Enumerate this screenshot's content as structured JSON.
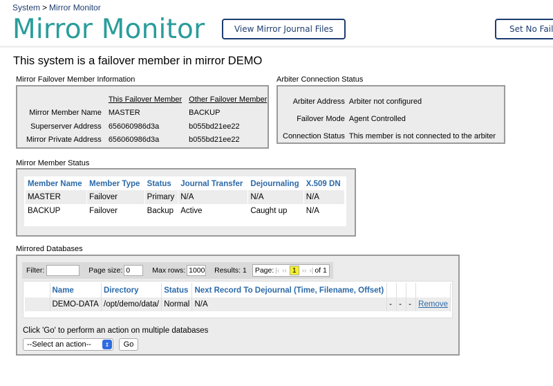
{
  "breadcrumb": {
    "items": [
      "System",
      "Mirror Monitor"
    ],
    "separator": ">"
  },
  "header": {
    "title": "Mirror Monitor",
    "buttons": {
      "journal": "View Mirror Journal Files",
      "set_no_failover": "Set No Failover"
    }
  },
  "main_heading": "This system is a failover member in mirror DEMO",
  "failover_info": {
    "title": "Mirror Failover Member Information",
    "col_this": "This Failover Member",
    "col_other": "Other Failover Member",
    "rows": [
      {
        "label": "Mirror Member Name",
        "this": "MASTER",
        "other": "BACKUP"
      },
      {
        "label": "Superserver Address",
        "this": "656060986d3a",
        "other": "b055bd21ee22"
      },
      {
        "label": "Mirror Private Address",
        "this": "656060986d3a",
        "other": "b055bd21ee22"
      }
    ]
  },
  "arbiter": {
    "title": "Arbiter Connection Status",
    "rows": [
      {
        "label": "Arbiter Address",
        "value": "Arbiter not configured"
      },
      {
        "label": "Failover Mode",
        "value": "Agent Controlled"
      },
      {
        "label": "Connection Status",
        "value": "This member is not connected to the arbiter"
      }
    ]
  },
  "member_status": {
    "title": "Mirror Member Status",
    "headers": [
      "Member Name",
      "Member Type",
      "Status",
      "Journal Transfer",
      "Dejournaling",
      "X.509 DN"
    ],
    "rows": [
      [
        "MASTER",
        "Failover",
        "Primary",
        "N/A",
        "N/A",
        "N/A"
      ],
      [
        "BACKUP",
        "Failover",
        "Backup",
        "Active",
        "Caught up",
        "N/A"
      ]
    ]
  },
  "databases": {
    "title": "Mirrored Databases",
    "filter_label": "Filter:",
    "filter_value": "",
    "page_size_label": "Page size:",
    "page_size": "0",
    "max_rows_label": "Max rows:",
    "max_rows": "1000",
    "results_label": "Results: 1",
    "page_label": "Page:",
    "pager": {
      "first": "|‹",
      "prev": "‹‹",
      "current": "1",
      "next": "››",
      "last": "›|",
      "of": "of 1"
    },
    "headers": [
      "Name",
      "Directory",
      "Status",
      "Next Record To Dejournal (Time, Filename, Offset)"
    ],
    "rows": [
      {
        "name": "DEMO-DATA",
        "directory": "/opt/demo/data/",
        "status": "Normal",
        "next": "N/A",
        "c1": "-",
        "c2": "-",
        "c3": "-",
        "action": "Remove"
      }
    ],
    "go_hint": "Click 'Go' to perform an action on multiple databases",
    "select_value": "--Select an action--",
    "go_label": "Go"
  },
  "colors": {
    "title": "#2a9d9b",
    "navy": "#1d3c6e",
    "link": "#2c6aa8",
    "panel": "#ececec",
    "border": "#9a9a9a",
    "highlight": "#f5f029"
  }
}
